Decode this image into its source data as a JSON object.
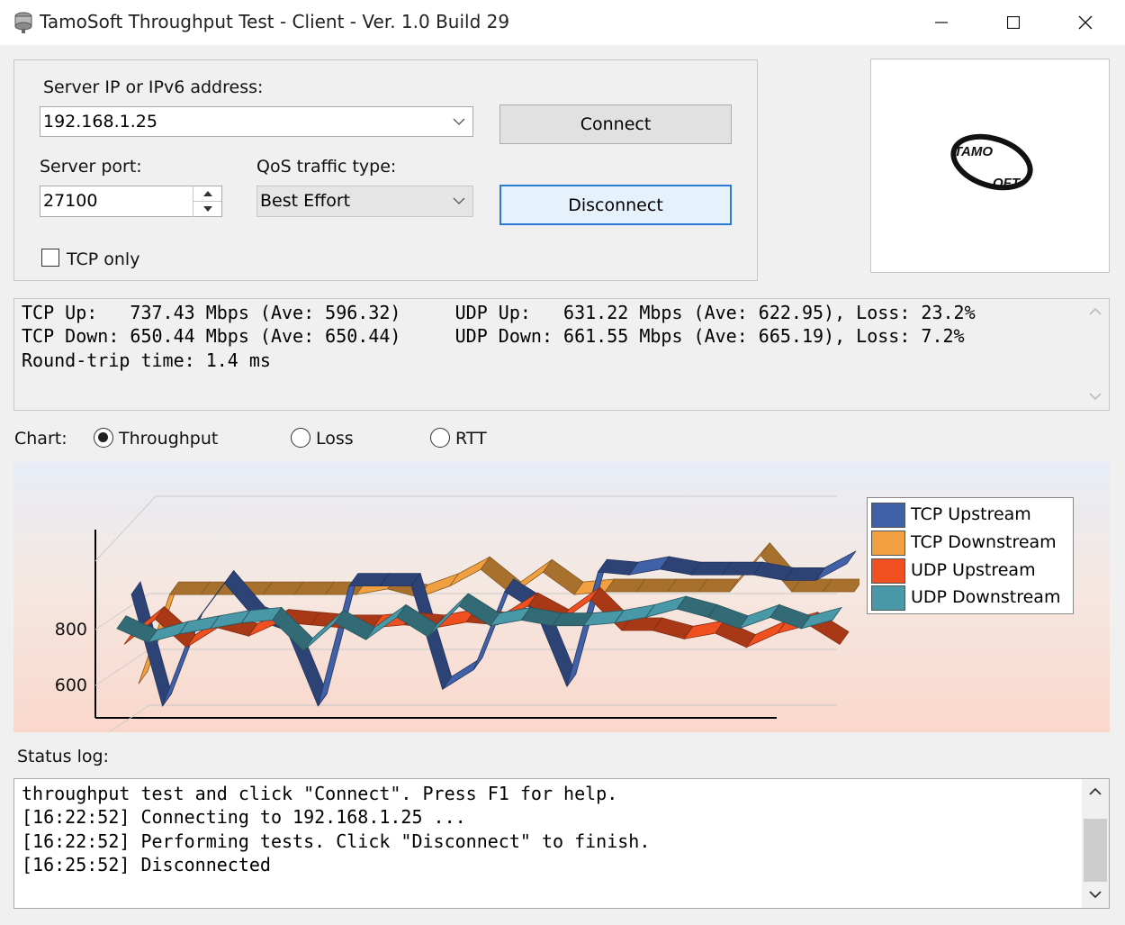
{
  "window": {
    "title": "TamoSoft Throughput Test - Client - Ver. 1.0 Build 29",
    "controls": [
      "minimize",
      "maximize",
      "close"
    ]
  },
  "connection": {
    "server_label": "Server IP or IPv6  address:",
    "server_value": "192.168.1.25",
    "port_label": "Server port:",
    "port_value": "27100",
    "qos_label": "QoS traffic type:",
    "qos_value": "Best Effort",
    "tcp_only_label": "TCP only",
    "tcp_only_checked": false,
    "connect_label": "Connect",
    "disconnect_label": "Disconnect"
  },
  "logo": {
    "text_top": "TAMO",
    "text_bottom": "OFT"
  },
  "stats": {
    "line1": "TCP Up:   737.43 Mbps (Ave: 596.32)     UDP Up:   631.22 Mbps (Ave: 622.95), Loss: 23.2%",
    "line2": "TCP Down: 650.44 Mbps (Ave: 650.44)     UDP Down: 661.55 Mbps (Ave: 665.19), Loss: 7.2%",
    "line3": "Round-trip time: 1.4 ms"
  },
  "chart_selector": {
    "label": "Chart:",
    "options": [
      {
        "label": "Throughput",
        "selected": true
      },
      {
        "label": "Loss",
        "selected": false
      },
      {
        "label": "RTT",
        "selected": false
      }
    ]
  },
  "chart_data": {
    "type": "line",
    "style": "3d-ribbon",
    "ylim": [
      300,
      1000
    ],
    "yticks": [
      "400",
      "600",
      "800"
    ],
    "grid": true,
    "legend_position": "right",
    "series": [
      {
        "name": "TCP Upstream",
        "color": "#4060a8",
        "values": [
          810,
          410,
          700,
          850,
          720,
          680,
          410,
          840,
          840,
          840,
          470,
          540,
          820,
          750,
          480,
          890,
          880,
          900,
          880,
          880,
          880,
          860,
          860,
          920
        ]
      },
      {
        "name": "TCP Downstream",
        "color": "#f0a040",
        "values": [
          470,
          790,
          790,
          790,
          790,
          790,
          790,
          790,
          810,
          780,
          820,
          880,
          790,
          870,
          790,
          800,
          800,
          800,
          800,
          800,
          930,
          800,
          800,
          800
        ]
      },
      {
        "name": "UDP Upstream",
        "color": "#f05020",
        "values": [
          650,
          740,
          640,
          710,
          680,
          730,
          720,
          710,
          710,
          720,
          710,
          730,
          720,
          790,
          730,
          810,
          700,
          700,
          670,
          690,
          640,
          690,
          720,
          650
        ]
      },
      {
        "name": "UDP Downstream",
        "color": "#4898a8",
        "values": [
          720,
          670,
          700,
          720,
          740,
          750,
          640,
          740,
          680,
          760,
          690,
          800,
          730,
          750,
          730,
          730,
          740,
          760,
          790,
          760,
          720,
          760,
          720,
          750
        ]
      }
    ]
  },
  "status": {
    "label": "Status log:",
    "lines": [
      "throughput test and click \"Connect\". Press F1 for help.",
      "[16:22:52] Connecting to 192.168.1.25 ...",
      "[16:22:52] Performing tests. Click \"Disconnect\" to finish.",
      "[16:25:52] Disconnected"
    ]
  }
}
